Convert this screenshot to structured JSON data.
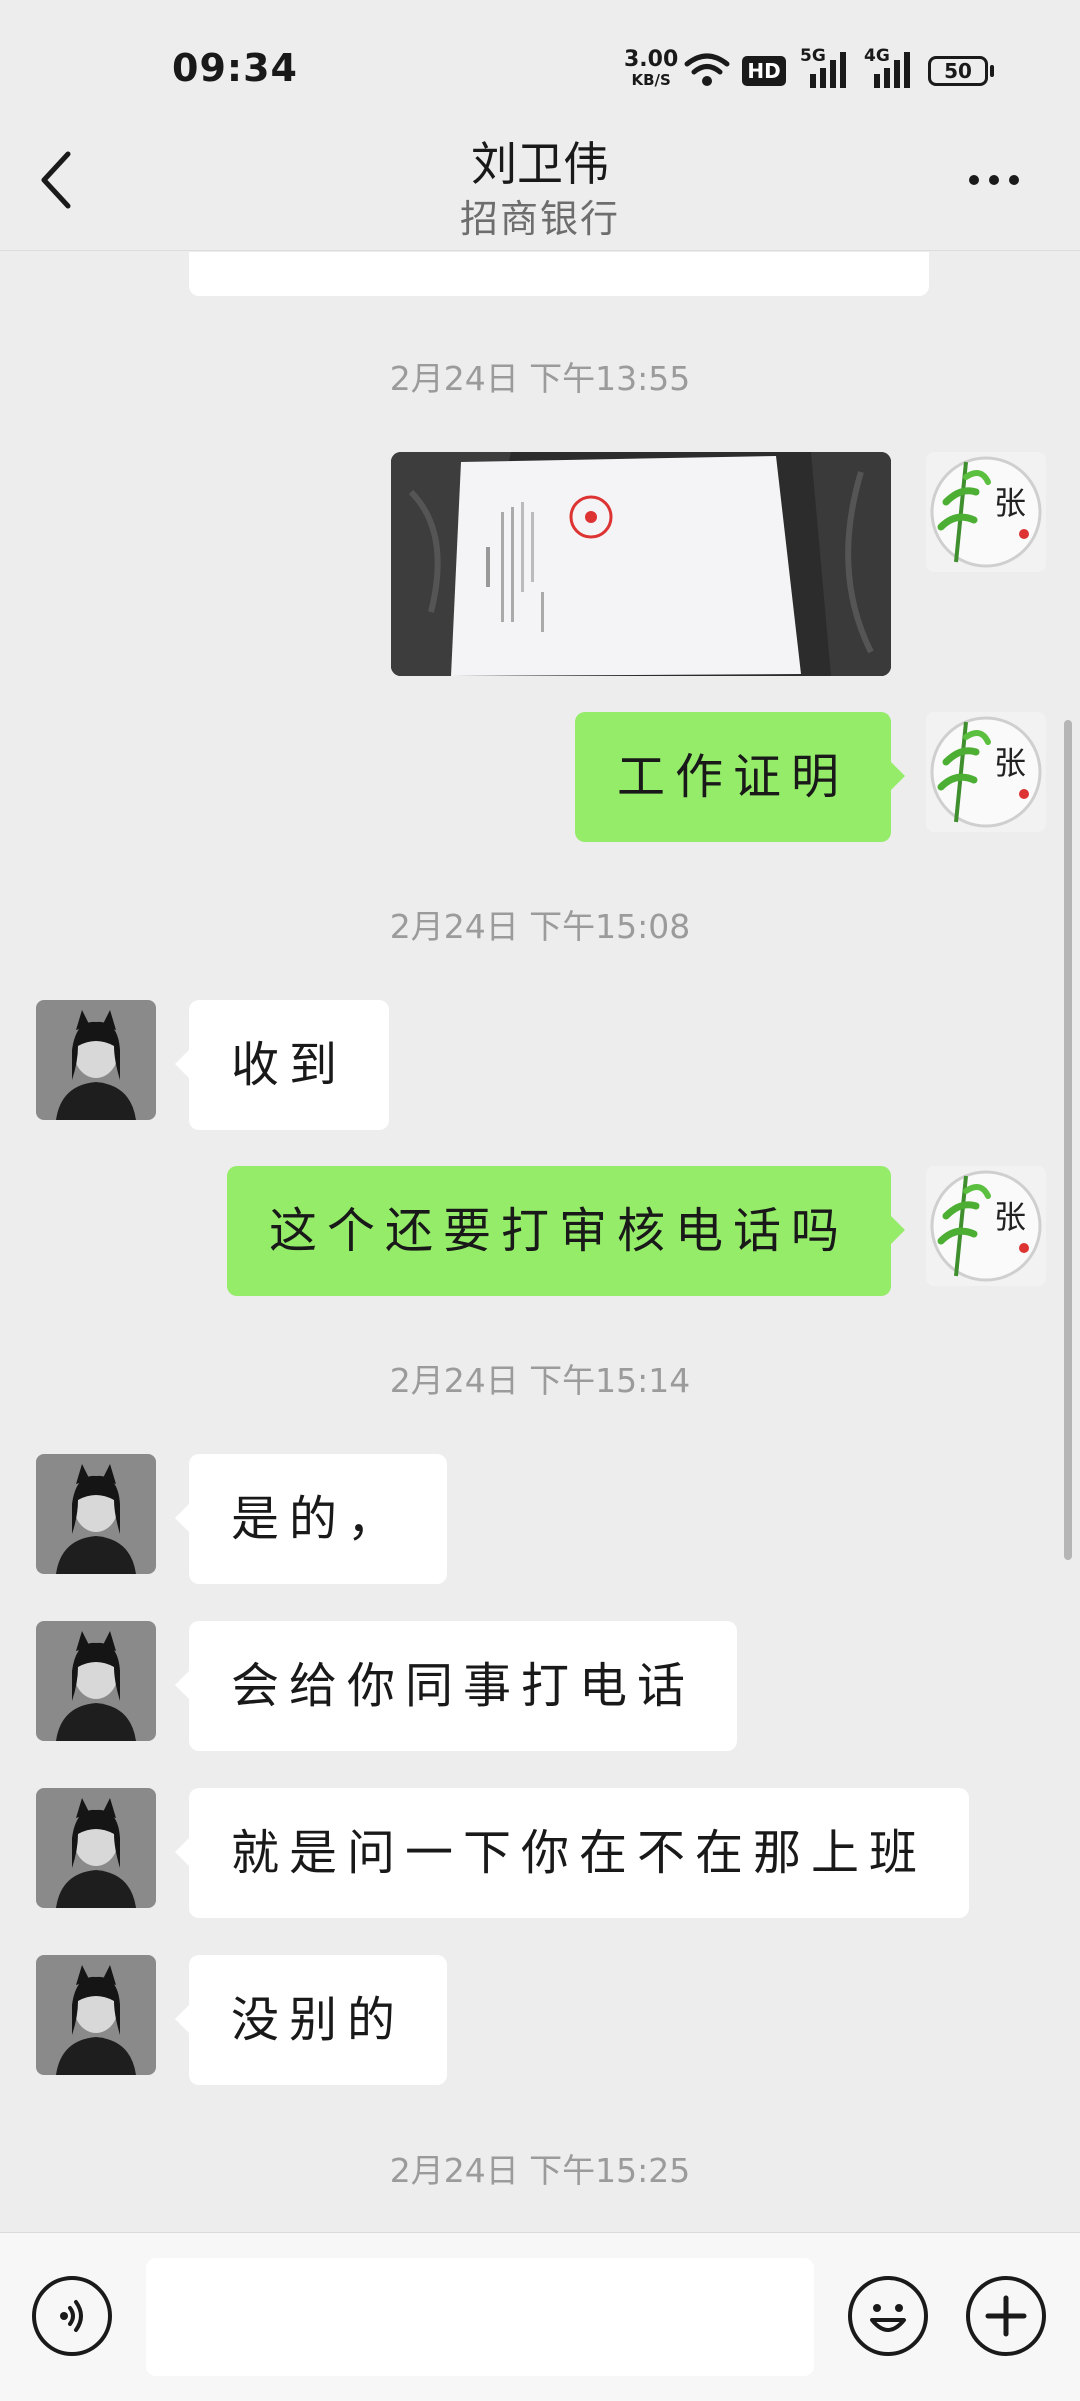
{
  "status_bar": {
    "time": "09:34",
    "net_speed": "3.00",
    "net_speed_unit": "KB/S",
    "hd_badge": "HD",
    "signal1_label": "5G",
    "signal2_label": "4G",
    "battery": "50"
  },
  "header": {
    "back_icon": "chevron-left-icon",
    "title": "刘卫伟",
    "subtitle": "招商银行",
    "more_icon": "more-dots-icon"
  },
  "messages": {
    "ts1": "2月24日 下午13:55",
    "m2_text": "工作证明",
    "ts2": "2月24日 下午15:08",
    "m3_text": "收到",
    "m4_text": "这个还要打审核电话吗",
    "ts3": "2月24日 下午15:14",
    "m5_text": "是的，",
    "m6_text": "会给你同事打电话",
    "m7_text": "就是问一下你在不在那上班",
    "m8_text": "没别的",
    "ts4": "2月24日 下午15:25"
  },
  "input_bar": {
    "voice_icon": "voice-icon",
    "emoji_icon": "emoji-icon",
    "plus_icon": "plus-icon"
  },
  "colors": {
    "background": "#ededed",
    "outgoing_bubble": "#95ec69",
    "incoming_bubble": "#ffffff"
  }
}
